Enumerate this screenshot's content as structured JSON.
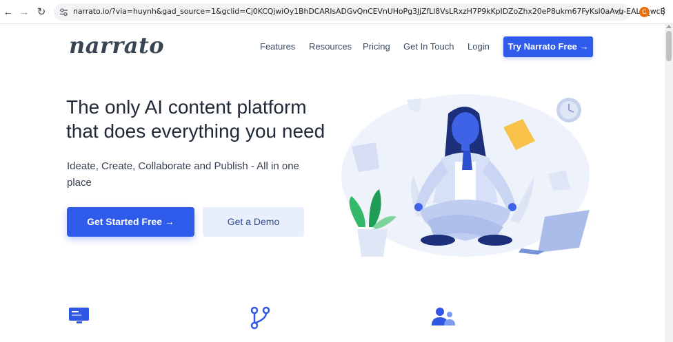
{
  "browser": {
    "url": "narrato.io/?via=huynh&gad_source=1&gclid=Cj0KCQjwiOy1BhDCARIsADGvQnCEVnUHoPg3JjZfLl8VsLRxzH7P9kKpIDZoZhx20eP8ukm67FyKsl0aAvu-EALw_wcB",
    "profile_initial": "C"
  },
  "header": {
    "logo": "narrato",
    "nav": [
      "Features",
      "Resources",
      "Pricing",
      "Get In Touch",
      "Login"
    ],
    "try_button": "Try Narrato Free →"
  },
  "hero": {
    "title_line1": "The only AI content platform",
    "title_line2": "that does everything you need",
    "subtitle": "Ideate, Create, Collaborate and Publish - All in one place",
    "primary_cta": "Get Started Free →",
    "secondary_cta": "Get a Demo"
  },
  "colors": {
    "accent": "#2e5bea",
    "text_dark": "#1f2937",
    "secondary_bg": "#e8eefc"
  },
  "features": {
    "icons": [
      "monitor-icon",
      "workflow-icon",
      "team-icon"
    ]
  }
}
